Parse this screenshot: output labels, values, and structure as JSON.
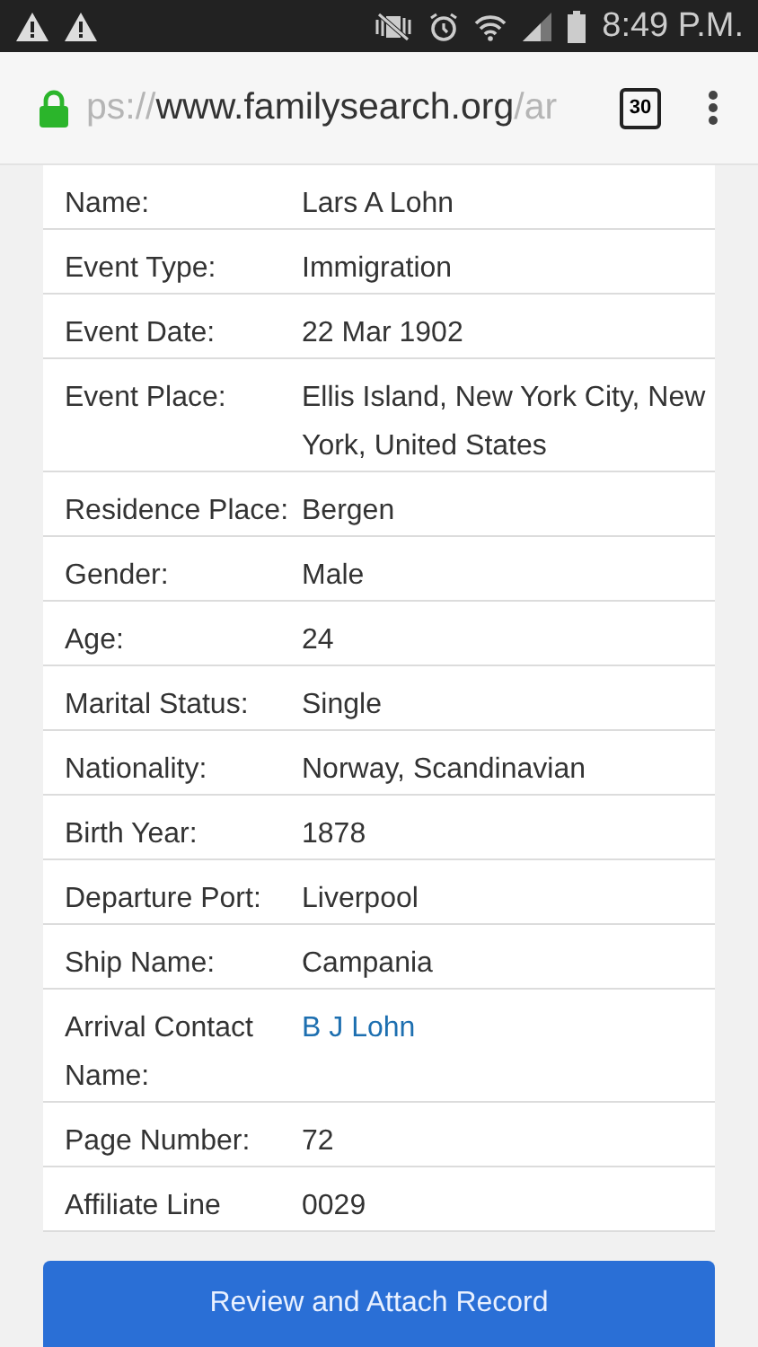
{
  "status_bar": {
    "time": "8:49 P.M."
  },
  "browser": {
    "url_scheme_part": "ps://",
    "url_main": "www.familysearch.org",
    "url_tail": "/ar",
    "tab_count": "30"
  },
  "record": [
    {
      "label": "Name:",
      "value": "Lars A Lohn",
      "kind": "text"
    },
    {
      "label": "Event Type:",
      "value": "Immigration",
      "kind": "text"
    },
    {
      "label": "Event Date:",
      "value": "22 Mar 1902",
      "kind": "text"
    },
    {
      "label": "Event Place:",
      "value": "Ellis Island, New York City, New York, United States",
      "kind": "text"
    },
    {
      "label": "Residence Place:",
      "value": "Bergen",
      "kind": "text"
    },
    {
      "label": "Gender:",
      "value": "Male",
      "kind": "text"
    },
    {
      "label": "Age:",
      "value": "24",
      "kind": "text"
    },
    {
      "label": "Marital Status:",
      "value": "Single",
      "kind": "text"
    },
    {
      "label": "Nationality:",
      "value": "Norway, Scandinavian",
      "kind": "text"
    },
    {
      "label": "Birth Year:",
      "value": "1878",
      "kind": "text"
    },
    {
      "label": "Departure Port:",
      "value": "Liverpool",
      "kind": "text"
    },
    {
      "label": "Ship Name:",
      "value": "Campania",
      "kind": "text"
    },
    {
      "label": "Arrival Contact Name:",
      "value": "B J Lohn",
      "kind": "link"
    },
    {
      "label": "Page Number:",
      "value": "72",
      "kind": "text"
    },
    {
      "label": "Affiliate Line",
      "value": "0029",
      "kind": "text"
    }
  ],
  "action_button": "Review and Attach Record"
}
